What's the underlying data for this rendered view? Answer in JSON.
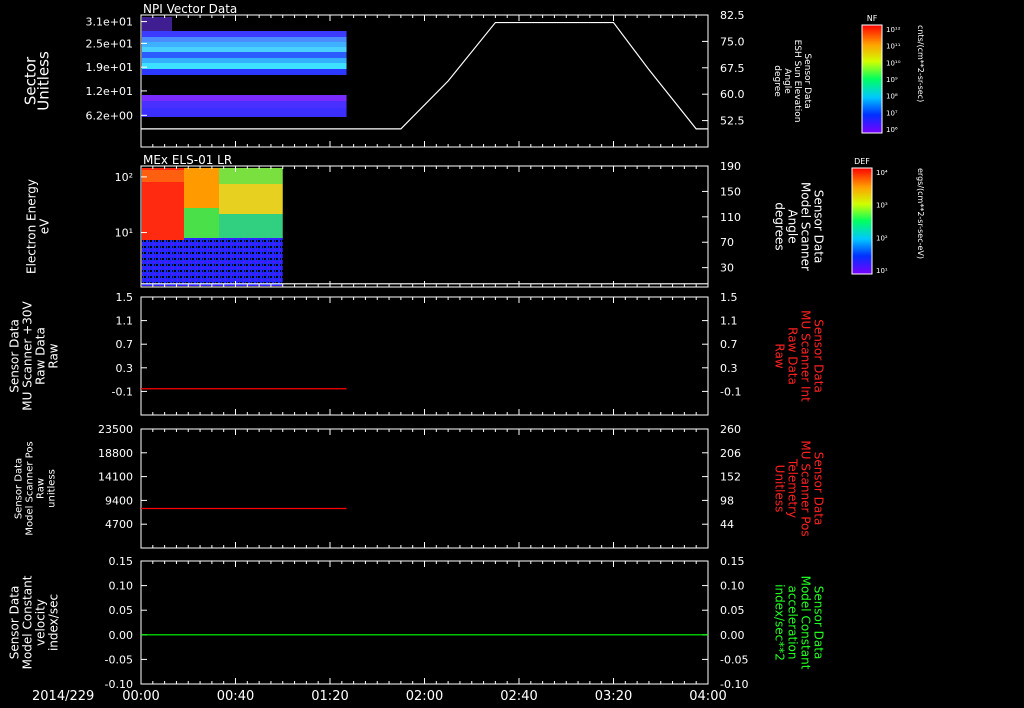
{
  "footer": {
    "date": "2014/229"
  },
  "time_ticks": [
    "00:00",
    "00:40",
    "01:20",
    "02:00",
    "02:40",
    "03:20",
    "04:00"
  ],
  "chart_data": [
    {
      "type": "heatmap",
      "title": "NPI Vector Data",
      "ylabel": [
        "Sector",
        "Unitless"
      ],
      "yticks": [
        "3.1e+01",
        "2.5e+01",
        "1.9e+01",
        "1.2e+01",
        "6.2e+00"
      ],
      "right_label": [
        "Sensor Data",
        "ESH Sun Elevation",
        "Angle",
        "degree"
      ],
      "right_ticks": [
        "82.5",
        "75.0",
        "67.5",
        "60.0",
        "52.5"
      ],
      "right_ylim": [
        47.5,
        82.5
      ],
      "overlay_series": {
        "name": "ESH Sun Elevation Angle",
        "color": "#ffffff",
        "x_minutes": [
          0,
          110,
          130,
          150,
          200,
          215,
          235,
          240
        ],
        "values": [
          52.3,
          52.3,
          65,
          80.5,
          80.5,
          68,
          52.3,
          52.3
        ]
      },
      "colorbar": {
        "title": "NF",
        "unit": "cnts/(cm**2-sr-sec)",
        "ticks": [
          "10¹²",
          "10¹¹",
          "10¹⁰",
          "10⁹",
          "10⁸",
          "10⁷",
          "10⁶"
        ]
      }
    },
    {
      "type": "heatmap",
      "title": "MEx ELS-01 LR",
      "ylabel": [
        "Electron Energy",
        "eV"
      ],
      "yticks": [
        "10²",
        "10¹"
      ],
      "right_label": [
        "Sensor Data",
        "Model Scanner",
        "Angle",
        "degrees"
      ],
      "right_ticks": [
        "190",
        "150",
        "110",
        "70",
        "30"
      ],
      "right_ylim": [
        0,
        190
      ],
      "overlay_series": {
        "name": "Model Scanner Angle",
        "color": "#ffffff",
        "x_minutes": [
          0,
          240
        ],
        "values": [
          5,
          5
        ]
      },
      "colorbar": {
        "title": "DEF",
        "unit": "ergs/(cm**2-sr-sec-eV)",
        "ticks": [
          "10⁴",
          "10³",
          "10²",
          "10¹"
        ]
      }
    },
    {
      "type": "line",
      "ylabel": [
        "Sensor Data",
        "MU Scanner +30V",
        "Raw Data",
        "Raw"
      ],
      "yticks": [
        "1.5",
        "1.1",
        "0.7",
        "0.3",
        "-0.1"
      ],
      "ylim": [
        -0.3,
        1.5
      ],
      "right_label": [
        "Sensor Data",
        "MU Scanner Int",
        "Raw Data",
        "Raw"
      ],
      "right_ticks": [
        "1.5",
        "1.1",
        "0.7",
        "0.3",
        "-0.1"
      ],
      "series": [
        {
          "color": "#ff0000",
          "x_minutes": [
            0,
            87
          ],
          "values": [
            0.1,
            0.1
          ]
        }
      ]
    },
    {
      "type": "line",
      "ylabel": [
        "Sensor Data",
        "Model Scanner Pos",
        "Raw",
        "unitless"
      ],
      "yticks": [
        "23500",
        "18800",
        "14100",
        "9400",
        "4700"
      ],
      "ylim": [
        0,
        23500
      ],
      "right_label": [
        "Sensor Data",
        "MU Scanner Pos",
        "Telemetry",
        "Unitless"
      ],
      "right_ticks": [
        "260",
        "206",
        "152",
        "98",
        "44"
      ],
      "series": [
        {
          "color": "#ff0000",
          "x_minutes": [
            0,
            87
          ],
          "values": [
            7800,
            7800
          ]
        }
      ]
    },
    {
      "type": "line",
      "ylabel": [
        "Sensor Data",
        "Model Constant",
        "velocity",
        "index/sec"
      ],
      "yticks": [
        "0.15",
        "0.10",
        "0.05",
        "0.00",
        "-0.05",
        "-0.10"
      ],
      "ylim": [
        -0.1,
        0.15
      ],
      "right_label": [
        "Sensor Data",
        "Model Constant",
        "acceleration",
        "index/sec**2"
      ],
      "right_ticks": [
        "0.15",
        "0.10",
        "0.05",
        "0.00",
        "-0.05",
        "-0.10"
      ],
      "series": [
        {
          "color": "#00ff00",
          "x_minutes": [
            0,
            240
          ],
          "values": [
            0.0,
            0.0
          ]
        }
      ]
    }
  ]
}
